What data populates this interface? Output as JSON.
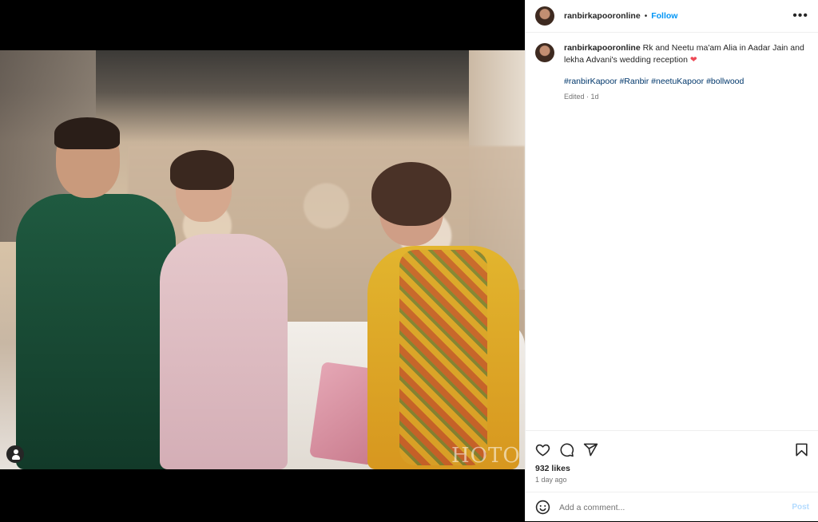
{
  "post": {
    "username": "ranbirkapooronline",
    "follow_label": "Follow",
    "separator": "•",
    "more_icon": "more-options-icon",
    "caption_text": "Rk and Neetu ma'am Alia in Aadar Jain and lekha Advani's wedding reception",
    "caption_emoji": "❤",
    "hashtags": [
      "#ranbirKapoor",
      "#Ranbir",
      "#neetuKapoor",
      "#bollwood"
    ],
    "edited_label": "Edited · 1d",
    "likes": "932 likes",
    "time_ago": "1 day ago",
    "comment_placeholder": "Add a comment...",
    "post_button": "Post",
    "watermark": "HOTO"
  },
  "colors": {
    "accent": "#0095f6",
    "heart": "#ed4956",
    "hashtag": "#00376b",
    "post_disabled": "#b3dbff"
  }
}
